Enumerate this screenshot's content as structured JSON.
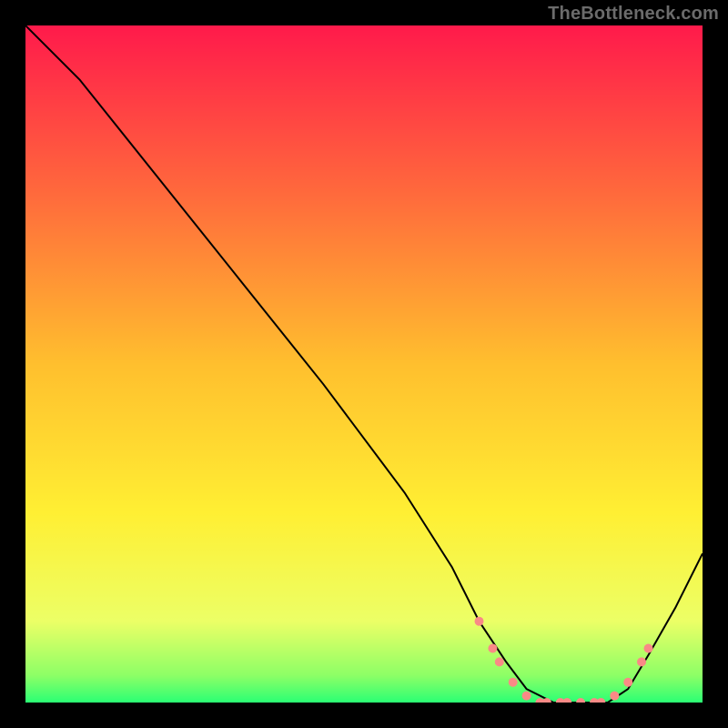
{
  "watermark": "TheBottleneck.com",
  "chart_data": {
    "type": "line",
    "title": "",
    "xlabel": "",
    "ylabel": "",
    "xlim": [
      0,
      100
    ],
    "ylim": [
      0,
      100
    ],
    "grid": false,
    "legend": false,
    "background": {
      "type": "vertical-gradient",
      "stops": [
        {
          "offset": 0.0,
          "color": "#ff1a4b"
        },
        {
          "offset": 0.25,
          "color": "#ff6a3c"
        },
        {
          "offset": 0.5,
          "color": "#ffbf2e"
        },
        {
          "offset": 0.72,
          "color": "#ffef33"
        },
        {
          "offset": 0.88,
          "color": "#ecff66"
        },
        {
          "offset": 0.96,
          "color": "#8dff66"
        },
        {
          "offset": 1.0,
          "color": "#2bff74"
        }
      ]
    },
    "series": [
      {
        "name": "bottleneck-curve",
        "color": "#000000",
        "width": 2,
        "x": [
          0,
          8,
          20,
          32,
          44,
          56,
          63,
          67,
          71,
          74,
          78,
          82,
          86,
          89,
          92,
          96,
          100
        ],
        "y": [
          100,
          92,
          77,
          62,
          47,
          31,
          20,
          12,
          6,
          2,
          0,
          0,
          0,
          2,
          7,
          14,
          22
        ]
      }
    ],
    "markers": {
      "name": "dot-cluster",
      "color": "#f98a86",
      "radius": 5,
      "points": [
        {
          "x": 67,
          "y": 12
        },
        {
          "x": 69,
          "y": 8
        },
        {
          "x": 70,
          "y": 6
        },
        {
          "x": 72,
          "y": 3
        },
        {
          "x": 74,
          "y": 1
        },
        {
          "x": 76,
          "y": 0
        },
        {
          "x": 77,
          "y": 0
        },
        {
          "x": 79,
          "y": 0
        },
        {
          "x": 80,
          "y": 0
        },
        {
          "x": 82,
          "y": 0
        },
        {
          "x": 84,
          "y": 0
        },
        {
          "x": 85,
          "y": 0
        },
        {
          "x": 87,
          "y": 1
        },
        {
          "x": 89,
          "y": 3
        },
        {
          "x": 91,
          "y": 6
        },
        {
          "x": 92,
          "y": 8
        }
      ]
    }
  }
}
